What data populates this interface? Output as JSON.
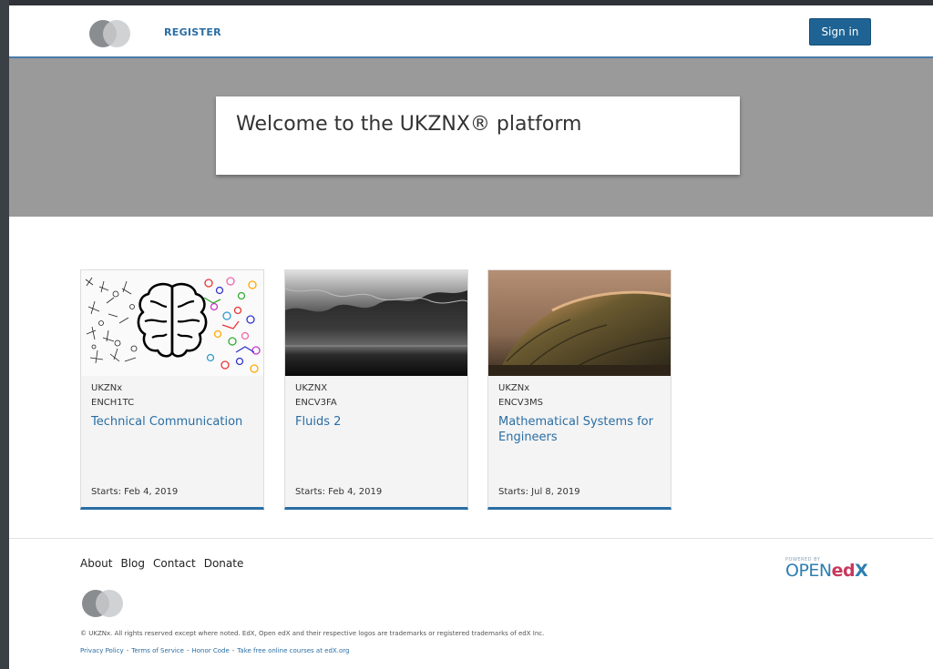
{
  "header": {
    "register_label": "REGISTER",
    "signin_label": "Sign in"
  },
  "hero": {
    "welcome_text": "Welcome to the UKZNX® platform"
  },
  "courses": [
    {
      "org": "UKZNx",
      "code": "ENCH1TC",
      "title": "Technical Communication",
      "starts": "Starts: Feb 4, 2019"
    },
    {
      "org": "UKZNX",
      "code": "ENCV3FA",
      "title": "Fluids 2",
      "starts": "Starts: Feb 4, 2019"
    },
    {
      "org": "UKZNx",
      "code": "ENCV3MS",
      "title": "Mathematical Systems for Engineers",
      "starts": "Starts: Jul 8, 2019"
    }
  ],
  "footer": {
    "nav": [
      "About",
      "Blog",
      "Contact",
      "Donate"
    ],
    "copyright": "© UKZNx. All rights reserved except where noted. EdX, Open edX and their respective logos are trademarks or registered trademarks of edX Inc.",
    "legal": [
      "Privacy Policy",
      "Terms of Service",
      "Honor Code",
      "Take free online courses at edX.org"
    ],
    "legal_sep": "-",
    "powered_by": "POWERED BY",
    "brand_open": "OPEN",
    "brand_ed": "ed",
    "brand_x": "X"
  },
  "colors": {
    "accent": "#2a6ea4",
    "signin_bg": "#1e6393",
    "hero_bg": "#9a9a9a"
  }
}
